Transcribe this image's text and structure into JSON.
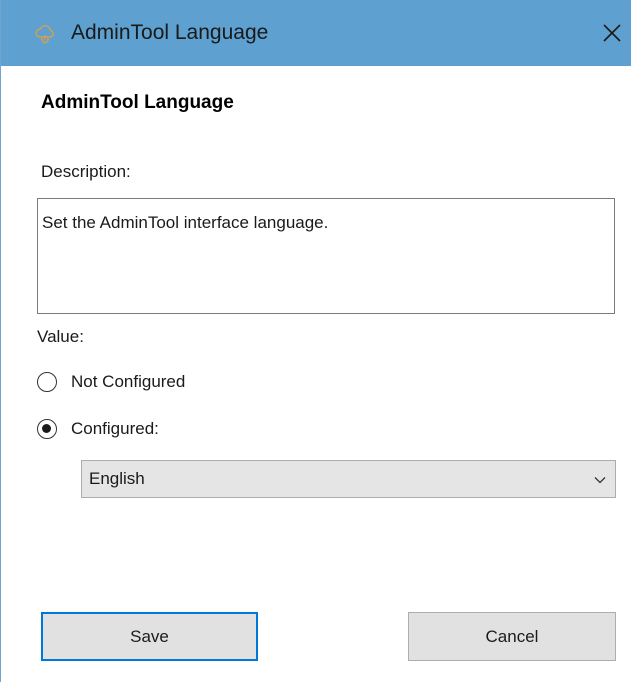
{
  "window": {
    "title": "AdminTool Language",
    "icons": {
      "app": "cloud-gear-icon",
      "close": "close-icon"
    }
  },
  "policy": {
    "heading": "AdminTool Language",
    "description_label": "Description:",
    "description_text": "Set the AdminTool interface language.",
    "value_label": "Value:"
  },
  "options": {
    "not_configured": {
      "label": "Not Configured",
      "selected": false
    },
    "configured": {
      "label": "Configured:",
      "selected": true
    }
  },
  "language_select": {
    "value": "English",
    "icon": "chevron-down-icon"
  },
  "buttons": {
    "save": "Save",
    "cancel": "Cancel"
  },
  "colors": {
    "titlebar": "#5ea0cf",
    "focus_border": "#0078d7",
    "button_bg": "#e1e1e1",
    "select_bg": "#e5e5e5"
  }
}
